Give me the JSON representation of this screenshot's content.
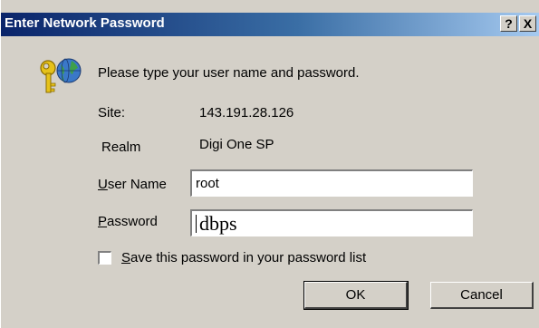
{
  "window": {
    "title": "Enter Network Password",
    "help_glyph": "?",
    "close_glyph": "X"
  },
  "dialog": {
    "prompt": "Please type your user name and password.",
    "site_label": "Site:",
    "site_value": "143.191.28.126",
    "realm_label": "Realm",
    "realm_value": "Digi One SP",
    "user_label_mnemonic": "U",
    "user_label_rest": "ser Name",
    "user_value": "root",
    "password_label_mnemonic": "P",
    "password_label_rest": "assword",
    "password_value": "dbps",
    "save_mnemonic": "S",
    "save_rest": "ave this password in your password list",
    "save_checked": false
  },
  "buttons": {
    "ok": "OK",
    "cancel": "Cancel"
  },
  "icons": {
    "dialog_icon": "key-globe-icon"
  },
  "colors": {
    "titlebar_start": "#0a246a",
    "titlebar_end": "#a6caf0",
    "face": "#d4d0c8"
  }
}
